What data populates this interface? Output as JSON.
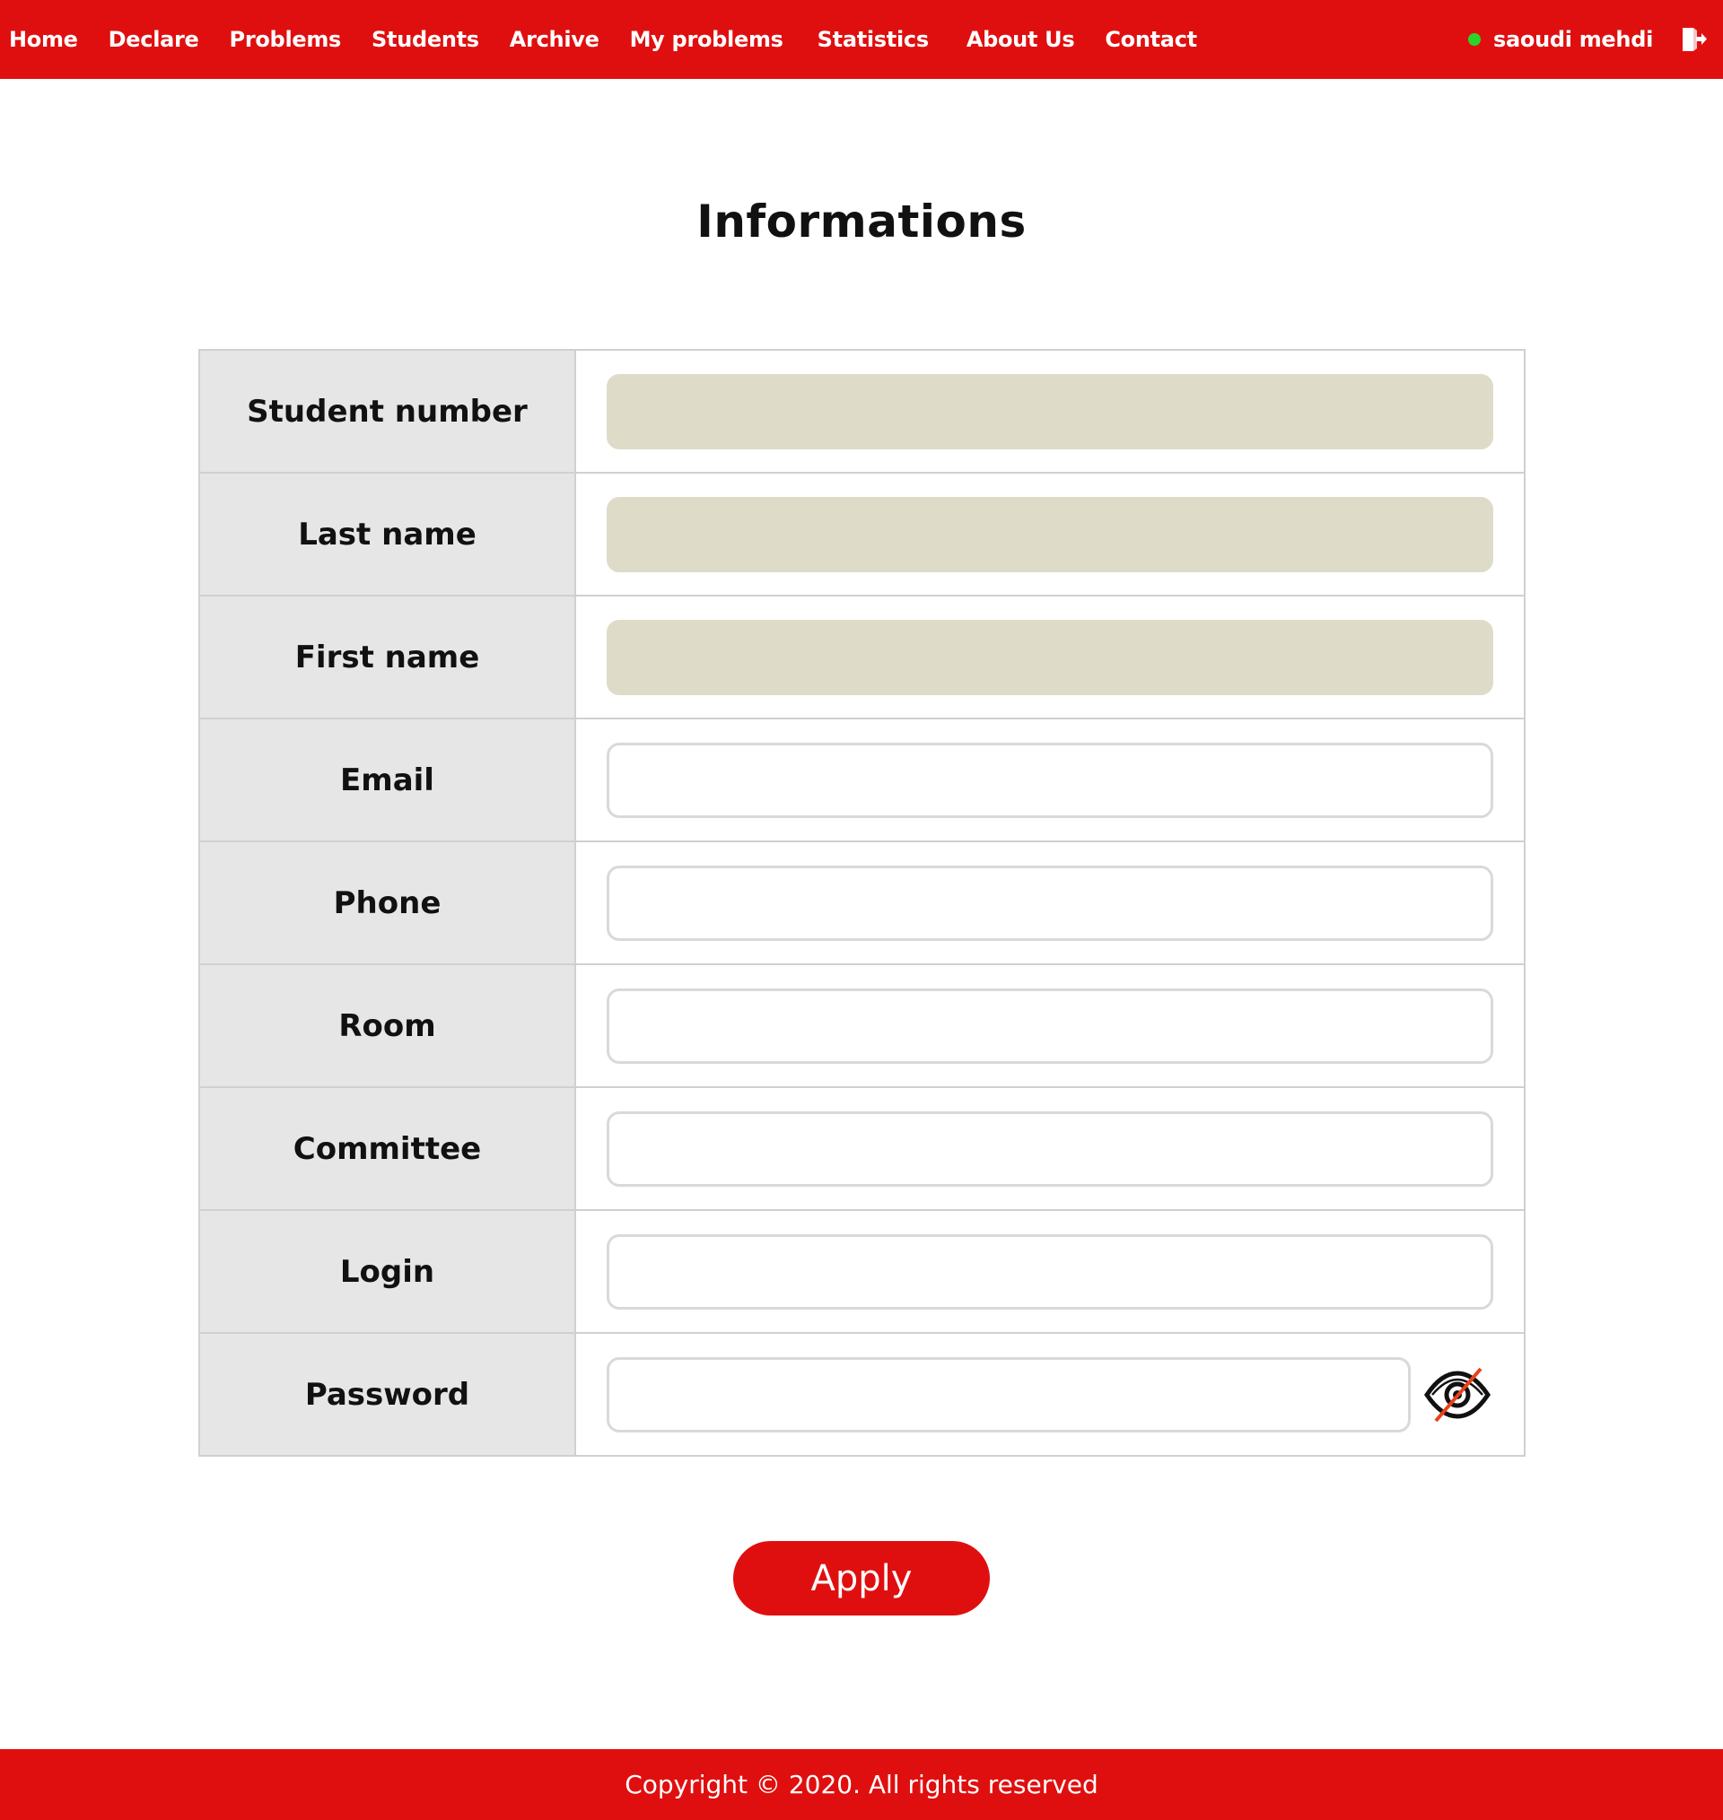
{
  "navbar": {
    "links": [
      "Home",
      "Declare",
      "Problems",
      "Students",
      "Archive",
      "My problems",
      "Statistics",
      "About Us",
      "Contact"
    ],
    "user": {
      "name": "saoudi mehdi",
      "status_color": "#2bd42b"
    },
    "logout_icon": "logout-icon",
    "bg_color": "#e00f0f"
  },
  "page": {
    "title": "Informations"
  },
  "form": {
    "fields": [
      {
        "label": "Student number",
        "value": "",
        "readonly": true
      },
      {
        "label": "Last name",
        "value": "",
        "readonly": true
      },
      {
        "label": "First name",
        "value": "",
        "readonly": true
      },
      {
        "label": "Email",
        "value": "",
        "readonly": false
      },
      {
        "label": "Phone",
        "value": "",
        "readonly": false
      },
      {
        "label": "Room",
        "value": "",
        "readonly": false
      },
      {
        "label": "Committee",
        "value": "",
        "readonly": false
      },
      {
        "label": "Login",
        "value": "",
        "readonly": false
      },
      {
        "label": "Password",
        "value": "",
        "readonly": false
      }
    ],
    "password_toggle_icon": "eye-slash-icon",
    "apply_label": "Apply"
  },
  "footer": {
    "text": "Copyright © 2020. All rights reserved"
  }
}
